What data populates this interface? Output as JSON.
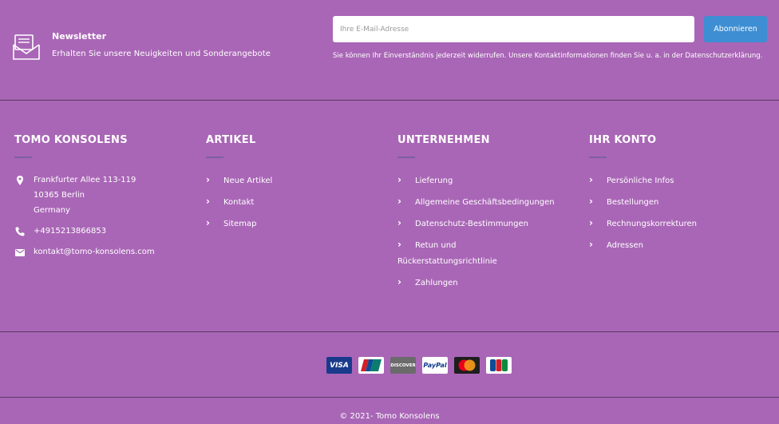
{
  "newsletter": {
    "title": "Newsletter",
    "description": "Erhalten Sie unsere Neuigkeiten und Sonderangebote",
    "email_placeholder": "Ihre E-Mail-Adresse",
    "email_value": "",
    "subscribe_label": "Abonnieren",
    "note": "Sie können Ihr Einverständnis jederzeit widerrufen. Unsere Kontaktinformationen finden Sie u. a. in der Datenschutzerklärung."
  },
  "store": {
    "title": "TOMO KONSOLENS",
    "address_line1": "Frankfurter Allee 113-119",
    "address_line2": "10365 Berlin",
    "address_line3": "Germany",
    "phone": "+4915213866853",
    "email": "kontakt@tomo-konsolens.com"
  },
  "artikel": {
    "title": "ARTIKEL",
    "items": [
      {
        "label": "Neue Artikel"
      },
      {
        "label": "Kontakt"
      },
      {
        "label": "Sitemap"
      }
    ]
  },
  "unternehmen": {
    "title": "UNTERNEHMEN",
    "items": [
      {
        "label": "Lieferung"
      },
      {
        "label": "Allgemeine Geschäftsbedingungen"
      },
      {
        "label": "Datenschutz-Bestimmungen"
      },
      {
        "label": "Retun und Rückerstattungsrichtlinie"
      },
      {
        "label": "Zahlungen"
      }
    ]
  },
  "konto": {
    "title": "IHR KONTO",
    "items": [
      {
        "label": "Persönliche Infos"
      },
      {
        "label": "Bestellungen"
      },
      {
        "label": "Rechnungskorrekturen"
      },
      {
        "label": "Adressen"
      }
    ]
  },
  "payments": {
    "visa": "VISA",
    "discover": "DISCOVER",
    "paypal": "PayPal"
  },
  "copyright": "© 2021- Tomo Konsolens",
  "colors": {
    "background": "#a966b6",
    "button": "#3d8ed3",
    "underline": "#7a5fa8"
  }
}
